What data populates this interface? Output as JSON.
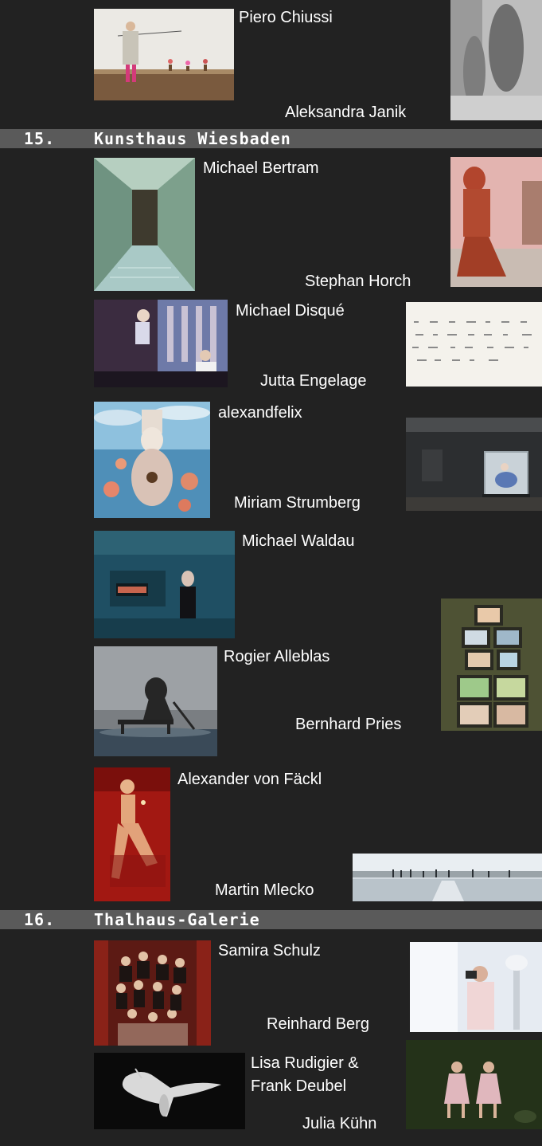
{
  "artists": {
    "a01": "Piero Chiussi",
    "a02": "Aleksandra Janik",
    "a03": "Michael Bertram",
    "a04": "Stephan Horch",
    "a05": "Michael Disqué",
    "a06": "Jutta Engelage",
    "a07": "alexandfelix",
    "a08": "Miriam Strumberg",
    "a09": "Michael Waldau",
    "a10": "Rogier Alleblas",
    "a11": "Bernhard Pries",
    "a12": "Alexander von Fäckl",
    "a13": "Martin Mlecko",
    "a14": "Samira Schulz",
    "a15": "Reinhard Berg",
    "a16_line1": "Lisa Rudigier &",
    "a16_line2": "Frank Deubel",
    "a17": "Julia Kühn"
  },
  "sections": [
    {
      "number": "15.",
      "title": "Kunsthaus Wiesbaden"
    },
    {
      "number": "16.",
      "title": "Thalhaus-Galerie"
    }
  ],
  "colors": {
    "background": "#222222",
    "header_bar": "#5a5a5a",
    "text": "#ffffff"
  }
}
